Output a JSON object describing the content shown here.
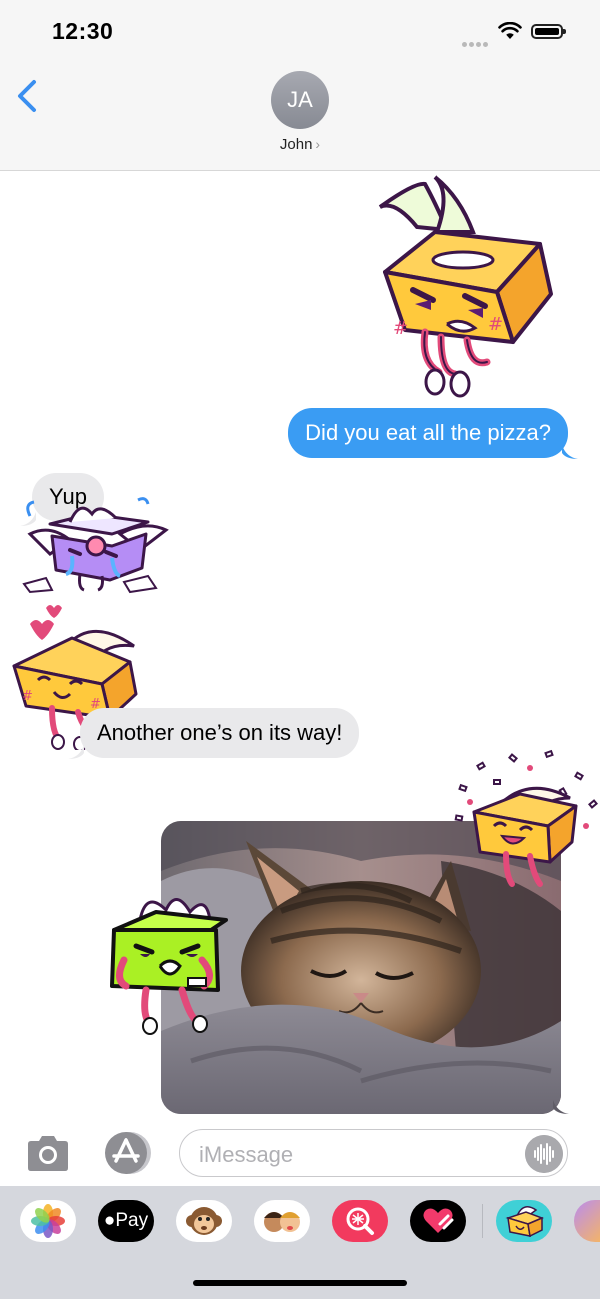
{
  "status_bar": {
    "time": "12:30"
  },
  "header": {
    "contact_initials": "JA",
    "contact_name": "John"
  },
  "messages": {
    "outgoing_1": "Did you eat all the pizza?",
    "incoming_1": "Yup",
    "incoming_2": "Another one’s on its way!"
  },
  "compose": {
    "placeholder": "iMessage"
  },
  "app_drawer": {
    "items": [
      {
        "name": "photos-app",
        "icon": "photos-icon"
      },
      {
        "name": "apple-pay-app",
        "label": "Pay",
        "icon": "apple-pay-icon"
      },
      {
        "name": "animoji-app",
        "icon": "monkey-icon"
      },
      {
        "name": "memoji-app",
        "icon": "memoji-stickers-icon"
      },
      {
        "name": "search-images-app",
        "icon": "image-search-icon"
      },
      {
        "name": "digital-touch-app",
        "icon": "heart-touch-icon"
      },
      {
        "name": "sticker-pack-app",
        "icon": "tissue-box-sticker-icon"
      },
      {
        "name": "more-app",
        "icon": "partial-app-icon"
      }
    ]
  },
  "colors": {
    "accent": "#3a9cf3",
    "incoming_bubble": "#e9e9eb",
    "header_bg": "#f6f6f6",
    "drawer_bg": "#d5d7dd"
  }
}
